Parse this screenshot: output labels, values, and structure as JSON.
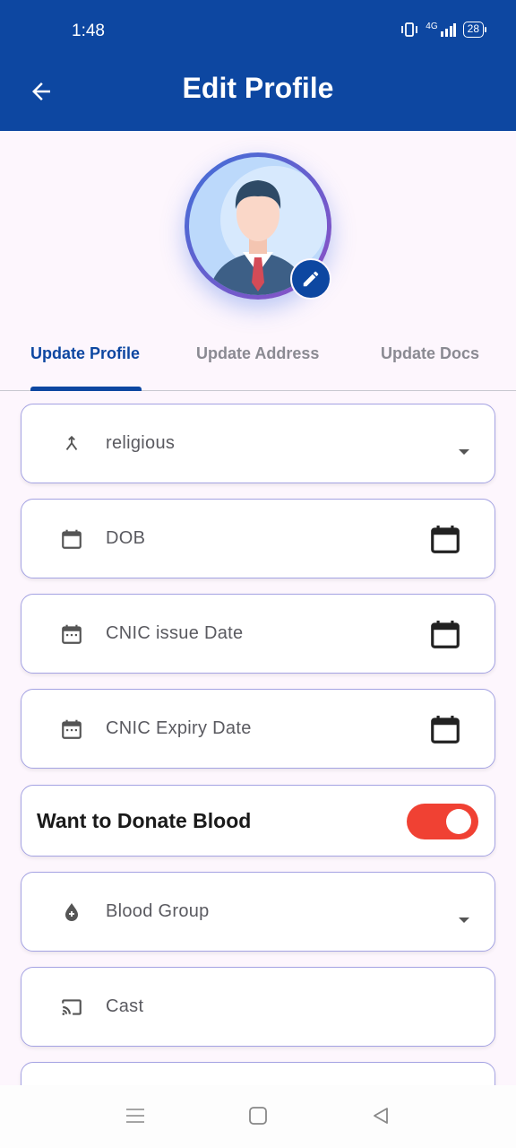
{
  "status_bar": {
    "time": "1:48",
    "network": "4G",
    "battery": "28"
  },
  "header": {
    "title": "Edit Profile"
  },
  "tabs": [
    {
      "label": "Update Profile",
      "active": true
    },
    {
      "label": "Update Address",
      "active": false
    },
    {
      "label": "Update Docs",
      "active": false
    }
  ],
  "fields": {
    "religious": {
      "label": "religious",
      "icon": "merge-icon"
    },
    "dob": {
      "label": "DOB",
      "icon": "calendar-icon"
    },
    "cnic_issue": {
      "label": "CNIC issue Date",
      "icon": "calendar-dots-icon"
    },
    "cnic_expiry": {
      "label": "CNIC Expiry Date",
      "icon": "calendar-dots-icon"
    },
    "blood_group": {
      "label": "Blood Group",
      "icon": "blood-drop-icon"
    },
    "cast": {
      "label": "Cast",
      "icon": "cast-icon"
    }
  },
  "donate_toggle": {
    "label": "Want to Donate Blood",
    "on": true
  },
  "colors": {
    "primary": "#0d47a1",
    "toggle_on": "#f04133",
    "field_border": "#a5a3e3",
    "background": "#fdf6fd"
  }
}
